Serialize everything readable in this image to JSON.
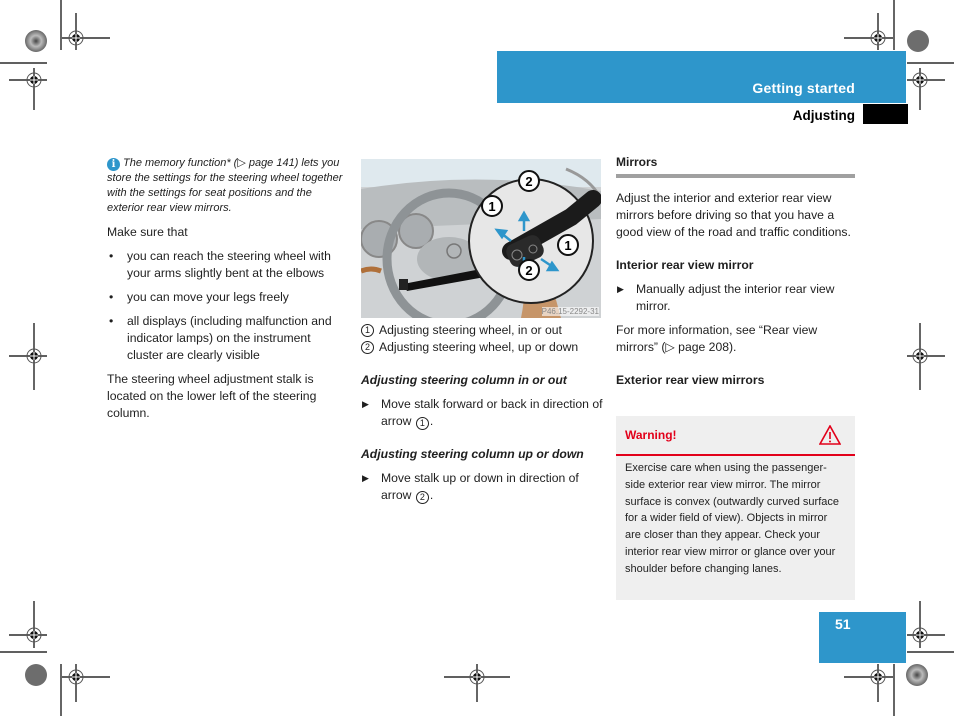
{
  "header": {
    "section_title": "Getting started",
    "subsection_title": "Adjusting",
    "page_number": "51",
    "accent_color": "#2e96cb"
  },
  "left_column": {
    "info_icon": "info-icon",
    "note": "The memory function* (▷ page 141) lets you store the settings for the steering wheel together with the settings for seat positions and the exterior rear view mirrors.",
    "intro": "Make sure that",
    "bullets": [
      "you can reach the steering wheel with your arms slightly bent at the elbows",
      "you can move your legs freely",
      "all displays (including malfunction and indicator lamps) on the instrument cluster are clearly visible"
    ],
    "closing": "The steering wheel adjustment stalk is located on the lower left of the steering column."
  },
  "figure": {
    "code": "P46.15-2292-31",
    "callouts": [
      "1",
      "2",
      "1",
      "2"
    ],
    "legend": [
      {
        "num": "1",
        "text": "Adjusting steering wheel, in or out"
      },
      {
        "num": "2",
        "text": "Adjusting steering wheel, up or down"
      }
    ]
  },
  "middle_column": {
    "heading1": "Adjusting steering column in or out",
    "step1_text": "Move stalk forward or back in direction of arrow",
    "step1_ref": "1",
    "heading2": "Adjusting steering column up or down",
    "step2_text": "Move stalk up or down in direction of arrow",
    "step2_ref": "2",
    "step_marker": "▶"
  },
  "right_column": {
    "section_heading": "Mirrors",
    "intro": "Adjust the interior and exterior rear view mirrors before driving so that you have a good view of the road and traffic conditions.",
    "interior_heading": "Interior rear view mirror",
    "interior_step": "Manually adjust the interior rear view mirror.",
    "interior_more": "For more information, see “Rear view mirrors” (▷ page 208).",
    "exterior_heading": "Exterior rear view mirrors",
    "warning": {
      "title": "Warning!",
      "icon": "warning-triangle-icon",
      "color": "#e2001a",
      "body": "Exercise care when using the passenger-side exterior rear view mirror. The mirror surface is convex (outwardly curved surface for a wider field of view). Objects in mirror are closer than they appear. Check your interior rear view mirror or glance over your shoulder before changing lanes."
    }
  }
}
